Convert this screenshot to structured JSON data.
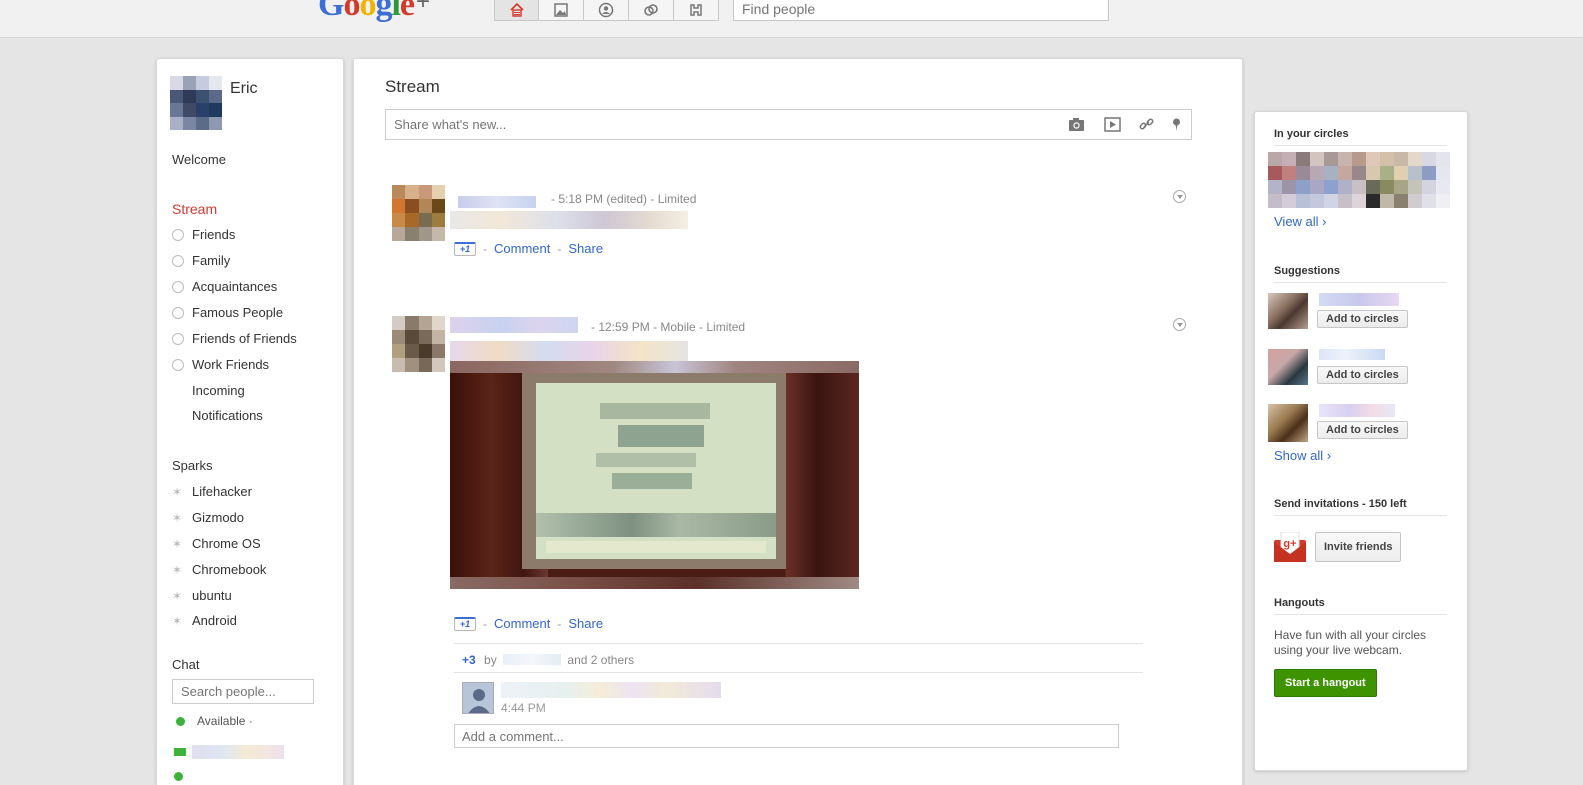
{
  "header": {
    "logo_letters": [
      "G",
      "o",
      "o",
      "g",
      "l",
      "e"
    ],
    "logo_plus": "+",
    "nav_icons": [
      "home-icon",
      "photos-icon",
      "profile-icon",
      "circles-icon",
      "games-icon"
    ],
    "search_placeholder": "Find people"
  },
  "sidebar": {
    "profile_name": "Eric",
    "welcome": "Welcome",
    "stream": "Stream",
    "circles": [
      "Friends",
      "Family",
      "Acquaintances",
      "Famous People",
      "Friends of Friends",
      "Work Friends"
    ],
    "incoming": "Incoming",
    "notifications": "Notifications",
    "sparks_label": "Sparks",
    "sparks": [
      "Lifehacker",
      "Gizmodo",
      "Chrome OS",
      "Chromebook",
      "ubuntu",
      "Android"
    ],
    "chat_label": "Chat",
    "chat_search_placeholder": "Search people...",
    "chat_status": "Available ·"
  },
  "main": {
    "title": "Stream",
    "share_placeholder": "Share what's new...",
    "share_icons": [
      "camera-icon",
      "video-icon",
      "link-icon",
      "location-icon"
    ],
    "posts": [
      {
        "meta": "-  5:18 PM (edited)  -  Limited",
        "plus_one": "+1",
        "comment": "Comment",
        "share": "Share",
        "dash": "-"
      },
      {
        "meta": "-  12:59 PM  -  Mobile  -  Limited",
        "plus_one": "+1",
        "comment": "Comment",
        "share": "Share",
        "dash": "-",
        "plus_count": "+3",
        "plus_by": "by",
        "plus_others": "and 2 others",
        "comment_time": "4:44 PM",
        "add_comment_placeholder": "Add a comment..."
      }
    ]
  },
  "right": {
    "in_circles": "In your circles",
    "view_all": "View all ›",
    "suggestions": "Suggestions",
    "add_to_circles": "Add to circles",
    "show_all": "Show all ›",
    "invitations": "Send invitations - 150 left",
    "invite_friends": "Invite friends",
    "hangouts": "Hangouts",
    "hangouts_text": "Have fun with all your circles using your live webcam.",
    "start_hangout": "Start a hangout"
  },
  "colors": {
    "accent_red": "#d33a2c",
    "link_blue": "#3366cc",
    "hangout_green": "#3d9400"
  }
}
